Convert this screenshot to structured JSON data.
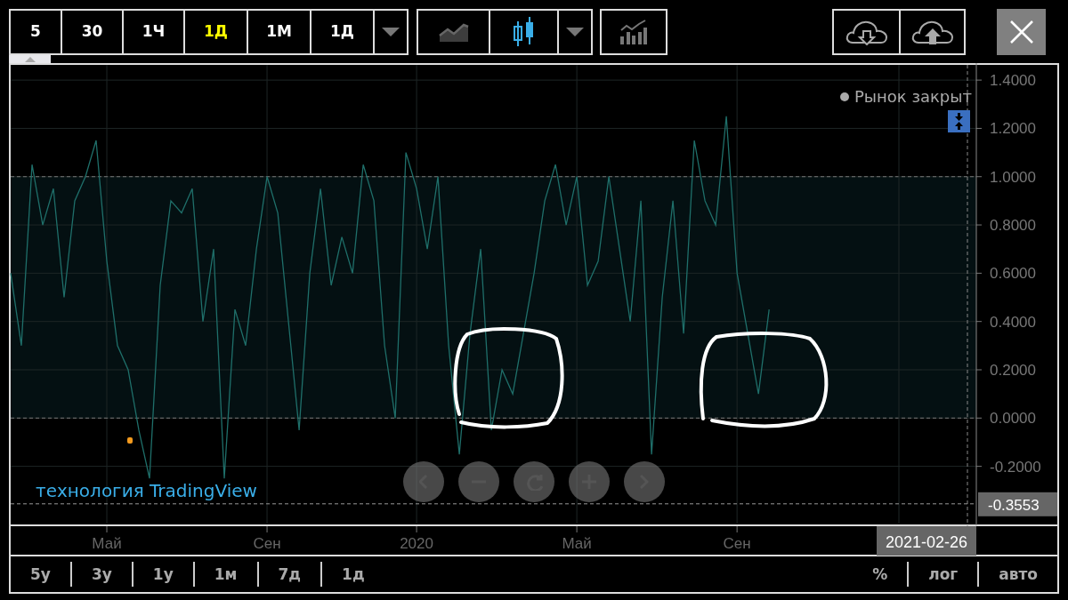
{
  "toolbar": {
    "intervals": [
      {
        "label": "5",
        "selected": false
      },
      {
        "label": "30",
        "selected": false
      },
      {
        "label": "1Ч",
        "selected": false
      },
      {
        "label": "1Д",
        "selected": true
      },
      {
        "label": "1М",
        "selected": false
      },
      {
        "label": "1Д",
        "selected": false
      }
    ],
    "chart_types": [
      {
        "kind": "line",
        "selected": false
      },
      {
        "kind": "candles",
        "selected": true
      }
    ]
  },
  "legend": {
    "status": "Рынок закрыт"
  },
  "branding": "технология TradingView",
  "chart": {
    "chart_data": {
      "type": "line",
      "categories": [
        null,
        null,
        null,
        null,
        null,
        null,
        null,
        null,
        null,
        "Май",
        null,
        null,
        null,
        null,
        null,
        null,
        null,
        null,
        null,
        null,
        null,
        null,
        null,
        null,
        "Сен",
        null,
        null,
        null,
        null,
        null,
        null,
        null,
        null,
        null,
        null,
        null,
        null,
        null,
        "2020",
        null,
        null,
        null,
        null,
        null,
        null,
        null,
        null,
        null,
        null,
        null,
        null,
        null,
        null,
        "Май",
        null,
        null,
        null,
        null,
        null,
        null,
        null,
        null,
        null,
        null,
        null,
        null,
        null,
        null,
        "Сен",
        null,
        null,
        null,
        null,
        null,
        null,
        null,
        null,
        null,
        null,
        null,
        null,
        null,
        null,
        null,
        null,
        null,
        null,
        null,
        null,
        null,
        null
      ],
      "series": [
        {
          "color": "#1f6f6a",
          "values": [
            0.6,
            0.3,
            1.05,
            0.8,
            0.95,
            0.5,
            0.9,
            1.0,
            1.15,
            0.65,
            0.3,
            0.2,
            -0.05,
            -0.25,
            0.55,
            0.9,
            0.85,
            0.95,
            0.4,
            0.7,
            -0.25,
            0.45,
            0.3,
            0.7,
            1.0,
            0.85,
            0.4,
            -0.05,
            0.6,
            0.95,
            0.55,
            0.75,
            0.6,
            1.05,
            0.9,
            0.3,
            0.0,
            1.1,
            0.95,
            0.7,
            1.0,
            0.3,
            -0.15,
            0.35,
            0.7,
            -0.05,
            0.2,
            0.1,
            0.35,
            0.6,
            0.9,
            1.05,
            0.8,
            1.0,
            0.55,
            0.65,
            1.0,
            0.7,
            0.4,
            0.9,
            -0.15,
            0.5,
            0.9,
            0.35,
            1.15,
            0.9,
            0.8,
            1.25,
            0.6,
            0.35,
            0.1,
            0.45,
            null,
            null,
            null,
            null,
            null,
            null,
            null,
            null,
            null,
            null,
            null,
            null,
            null,
            null,
            null,
            null,
            null,
            null,
            null
          ]
        }
      ],
      "ylim": [
        -0.437,
        1.463
      ],
      "grid": true,
      "yticks": [
        {
          "value": 1.4,
          "label": "1.4000"
        },
        {
          "value": 1.2,
          "label": "1.2000"
        },
        {
          "value": 1.0,
          "label": "1.0000"
        },
        {
          "value": 0.8,
          "label": "0.8000"
        },
        {
          "value": 0.6,
          "label": "0.6000"
        },
        {
          "value": 0.4,
          "label": "0.4000"
        },
        {
          "value": 0.2,
          "label": "0.2000"
        },
        {
          "value": 0.0,
          "label": "0.0000"
        },
        {
          "value": -0.2,
          "label": "-0.2000"
        }
      ],
      "bands": [
        {
          "axis": "y",
          "from": 0,
          "to": 1
        }
      ],
      "ref_lines": [
        {
          "axis": "y",
          "value": -0.3553,
          "label": "-0.3553"
        }
      ]
    },
    "date_label": "2021-02-26"
  },
  "range_buttons": [
    "5y",
    "3y",
    "1y",
    "1м",
    "7д",
    "1д"
  ],
  "scale_buttons": [
    "%",
    "лог",
    "авто"
  ]
}
